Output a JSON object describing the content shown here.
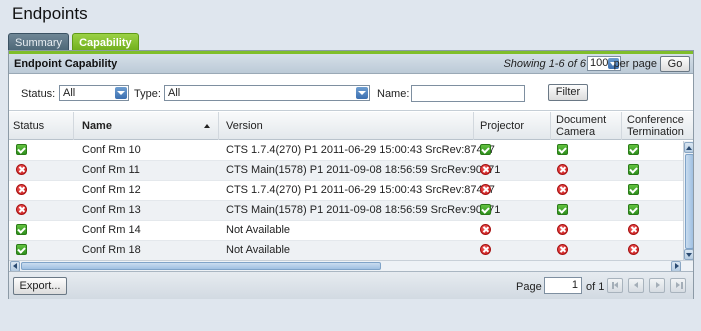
{
  "page_title": "Endpoints",
  "tabs": [
    {
      "label": "Summary",
      "active": false
    },
    {
      "label": "Capability",
      "active": true
    }
  ],
  "panel": {
    "title": "Endpoint Capability",
    "showing": "Showing 1-6 of 6",
    "per_page_value": "100",
    "per_page_label": "per page",
    "go_label": "Go"
  },
  "filters": {
    "status_label": "Status:",
    "status_value": "All",
    "type_label": "Type:",
    "type_value": "All",
    "name_label": "Name:",
    "name_value": "",
    "filter_button": "Filter"
  },
  "columns": [
    {
      "key": "status",
      "label": "Status"
    },
    {
      "key": "name",
      "label": "Name",
      "sorted": "ascending"
    },
    {
      "key": "version",
      "label": "Version"
    },
    {
      "key": "projector",
      "label": "Projector"
    },
    {
      "key": "document_camera",
      "label": "Document Camera"
    },
    {
      "key": "conference_termination",
      "label": "Conference Termination"
    }
  ],
  "rows": [
    {
      "status": "ok",
      "name": "Conf Rm 10",
      "version": "CTS 1.7.4(270) P1 2011-06-29 15:00:43 SrcRev:87497",
      "projector": "ok",
      "document_camera": "ok",
      "conference_termination": "ok"
    },
    {
      "status": "error",
      "name": "Conf Rm 11",
      "version": "CTS Main(1578) P1 2011-09-08 18:56:59 SrcRev:90071",
      "projector": "error",
      "document_camera": "error",
      "conference_termination": "ok"
    },
    {
      "status": "error",
      "name": "Conf Rm 12",
      "version": "CTS 1.7.4(270) P1 2011-06-29 15:00:43 SrcRev:87497",
      "projector": "error",
      "document_camera": "error",
      "conference_termination": "ok"
    },
    {
      "status": "error",
      "name": "Conf Rm 13",
      "version": "CTS Main(1578) P1 2011-09-08 18:56:59 SrcRev:90071",
      "projector": "ok",
      "document_camera": "ok",
      "conference_termination": "ok"
    },
    {
      "status": "ok",
      "name": "Conf Rm 14",
      "version": "Not Available",
      "projector": "error",
      "document_camera": "error",
      "conference_termination": "error"
    },
    {
      "status": "ok",
      "name": "Conf Rm 18",
      "version": "Not Available",
      "projector": "error",
      "document_camera": "error",
      "conference_termination": "error"
    }
  ],
  "footer": {
    "export_label": "Export...",
    "page_label": "Page",
    "page_value": "1",
    "of_label": "of 1"
  },
  "icons": {
    "ok": "check-icon",
    "error": "error-icon"
  },
  "colors": {
    "accent_green": "#7fbe2a",
    "ok_green": "#2d8f1c",
    "error_red": "#c51717"
  }
}
